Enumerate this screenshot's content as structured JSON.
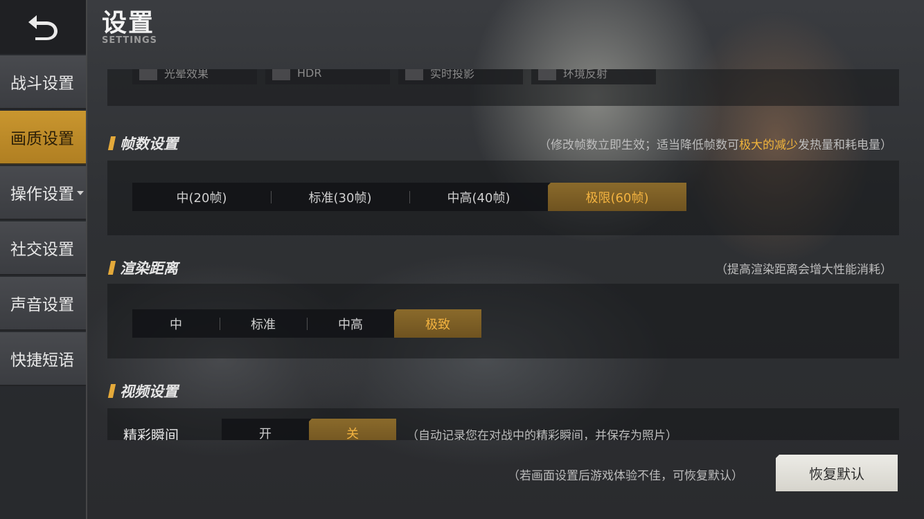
{
  "header": {
    "title": "设置",
    "subtitle": "SETTINGS"
  },
  "sidebar": {
    "items": [
      {
        "label": "战斗设置"
      },
      {
        "label": "画质设置",
        "active": true
      },
      {
        "label": "操作设置",
        "has_dropdown": true
      },
      {
        "label": "社交设置"
      },
      {
        "label": "声音设置"
      },
      {
        "label": "快捷短语"
      }
    ]
  },
  "effects": {
    "options": [
      {
        "label": "光晕效果",
        "checked": false
      },
      {
        "label": "HDR",
        "checked": false
      },
      {
        "label": "实时投影",
        "checked": false
      },
      {
        "label": "环境反射",
        "checked": false
      }
    ]
  },
  "frame_rate": {
    "title": "帧数设置",
    "note_prefix": "（修改帧数立即生效；适当降低帧数可",
    "note_highlight": "极大的减少",
    "note_suffix": "发热量和耗电量）",
    "options": [
      "中(20帧)",
      "标准(30帧)",
      "中高(40帧)",
      "极限(60帧)"
    ],
    "selected": "极限(60帧)"
  },
  "render_distance": {
    "title": "渲染距离",
    "note": "（提高渲染距离会增大性能消耗）",
    "options": [
      "中",
      "标准",
      "中高",
      "极致"
    ],
    "selected": "极致"
  },
  "video": {
    "title": "视频设置",
    "highlight_moment": {
      "label": "精彩瞬间",
      "options": [
        "开",
        "关"
      ],
      "selected": "关",
      "note": "（自动记录您在对战中的精彩瞬间，并保存为照片）"
    }
  },
  "footer": {
    "note": "（若画面设置后游戏体验不佳，可恢复默认）",
    "reset_label": "恢复默认"
  },
  "colors": {
    "accent": "#e4a93a",
    "active_text": "#f3b340",
    "active_nav": "#c9962f"
  }
}
